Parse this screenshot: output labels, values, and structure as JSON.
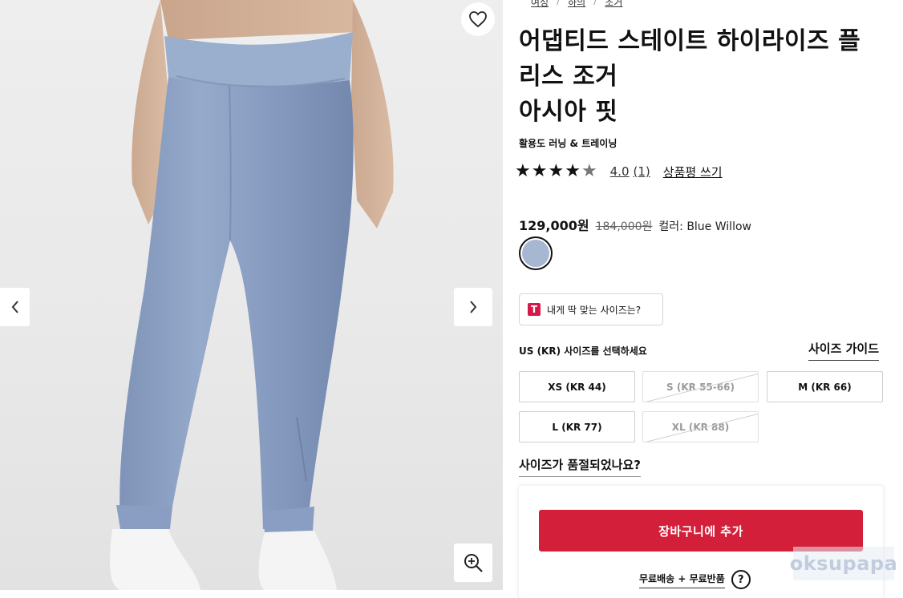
{
  "breadcrumb": [
    "여성",
    "하의",
    "조거"
  ],
  "product": {
    "title_line1": "어댑티드 스테이트 하이라이즈 플",
    "title_line2": "리스 조거",
    "title_line3": "아시아 핏",
    "activity": "활용도 러닝 & 트레이닝",
    "rating_value": "4.0",
    "rating_count": "(1)",
    "rating_stars": 4,
    "write_review": "상품평 쓰기",
    "price": "129,000원",
    "original_price": "184,000원",
    "color_label": "컬러: Blue Willow",
    "swatch_color": "#a6b7d2"
  },
  "fit": {
    "logo": "T",
    "label": "내게 딱 맞는 사이즈는?"
  },
  "sizes": {
    "select_label": "US (KR) 사이즈를 선택하세요",
    "guide_label": "사이즈 가이드",
    "options": [
      {
        "label": "XS (KR 44)",
        "available": true
      },
      {
        "label": "S (KR 55-66)",
        "available": false
      },
      {
        "label": "M (KR 66)",
        "available": true
      },
      {
        "label": "L (KR 77)",
        "available": true
      },
      {
        "label": "XL (KR 88)",
        "available": false
      }
    ],
    "soldout_link": "사이즈가 품절되었나요?"
  },
  "cart": {
    "add_label": "장바구니에 추가",
    "shipping_label": "무료배송 + 무료반품",
    "help_icon": "?"
  },
  "colors": {
    "accent": "#d31f3a",
    "fit_logo": "#d6184b",
    "pants": "#8fa3c6"
  },
  "watermark": "oksupapa",
  "icons": {
    "wishlist": "heart-icon",
    "prev": "chevron-left-icon",
    "next": "chevron-right-icon",
    "zoom": "zoom-in-icon"
  }
}
